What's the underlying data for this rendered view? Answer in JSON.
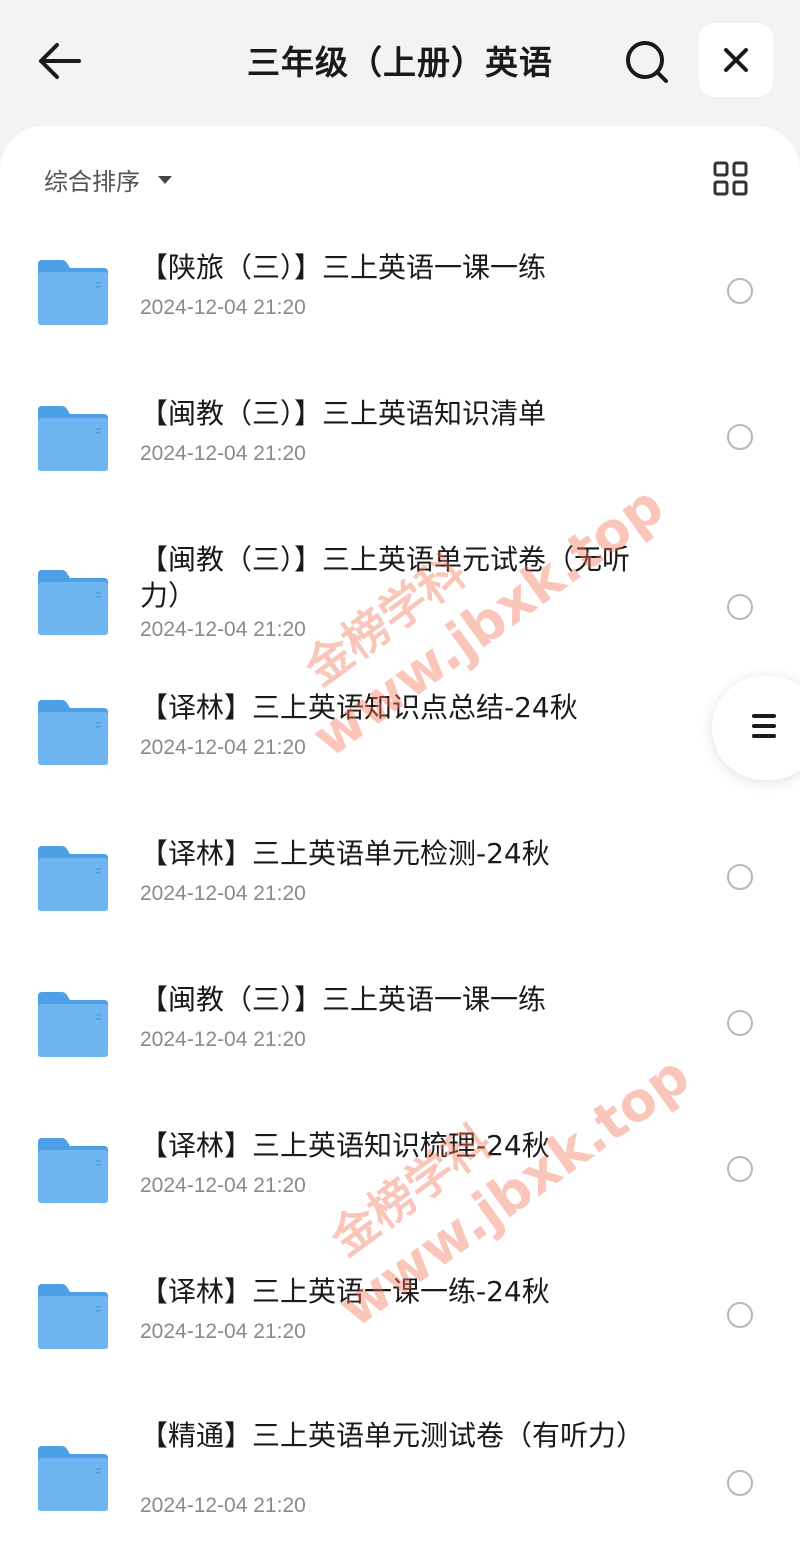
{
  "header": {
    "title": "三年级（上册）英语",
    "back_icon": "arrow-left-icon",
    "search_icon": "search-icon",
    "close_icon": "close-icon"
  },
  "toolbar": {
    "sort_label": "综合排序",
    "sort_icon": "caret-down-icon",
    "view_icon": "grid-view-icon"
  },
  "items": [
    {
      "title": "【陕旅（三）】三上英语一课一练",
      "date": "2024-12-04 21:20"
    },
    {
      "title": "【闽教（三）】三上英语知识清单",
      "date": "2024-12-04 21:20"
    },
    {
      "title": "【闽教（三）】三上英语单元试卷（无听力）",
      "date": "2024-12-04 21:20"
    },
    {
      "title": "【译林】三上英语知识点总结-24秋",
      "date": "2024-12-04 21:20"
    },
    {
      "title": "【译林】三上英语单元检测-24秋",
      "date": "2024-12-04 21:20"
    },
    {
      "title": "【闽教（三）】三上英语一课一练",
      "date": "2024-12-04 21:20"
    },
    {
      "title": "【译林】三上英语知识梳理-24秋",
      "date": "2024-12-04 21:20"
    },
    {
      "title": "【译林】三上英语一课一练-24秋",
      "date": "2024-12-04 21:20"
    },
    {
      "title": "【精通】三上英语单元测试卷（有听力）",
      "date": "2024-12-04 21:20"
    }
  ],
  "floating": {
    "menu_icon": "menu-icon"
  },
  "watermark": {
    "line1": "金榜学科",
    "line2": "www.jbxk.top"
  },
  "colors": {
    "folder": "#5aa9ec",
    "background": "#f3f3f5",
    "panel": "#ffffff",
    "watermark": "#f4785a"
  }
}
